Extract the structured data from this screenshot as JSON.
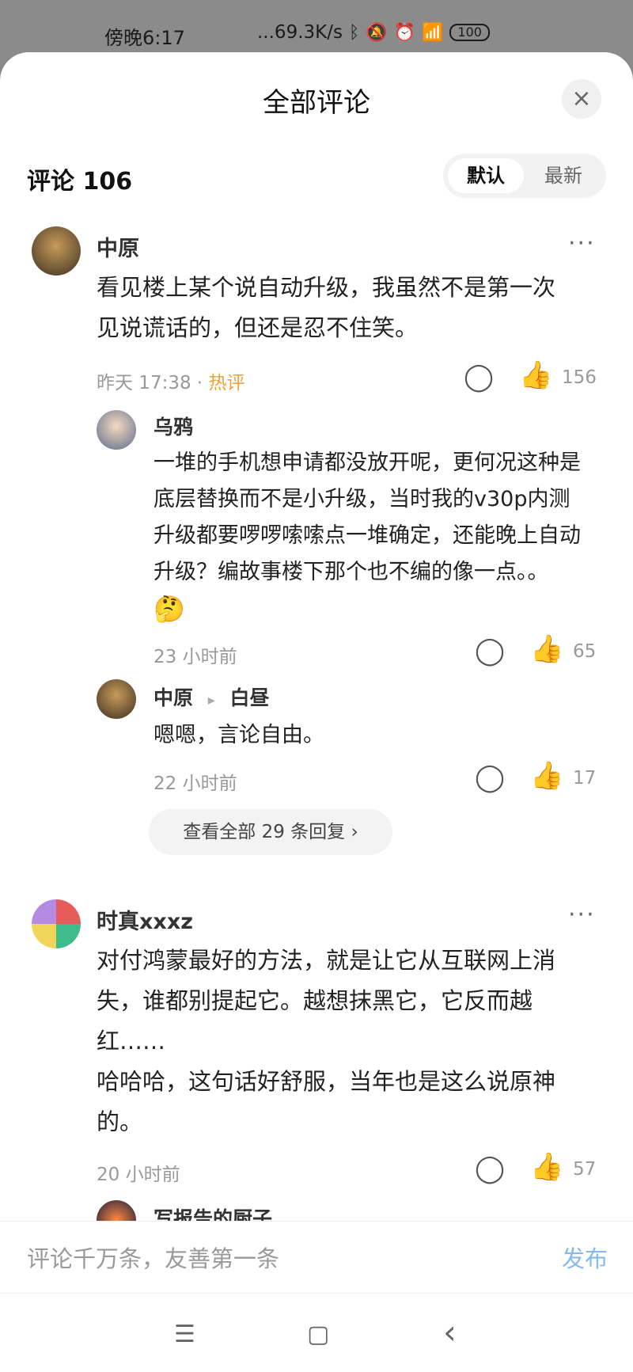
{
  "status": {
    "time": "傍晚6:17",
    "network": "...69.3K/s",
    "battery": "100"
  },
  "sheet": {
    "title": "全部评论",
    "close_icon": "×"
  },
  "comments_header": {
    "label": "评论 106",
    "sort_default": "默认",
    "sort_latest": "最新"
  },
  "comment1": {
    "name": "中原",
    "text_line1": "看见楼上某个说自动升级，我虽然不是第一次",
    "text_line2": "见说谎话的，但还是忍不住笑。",
    "time": "昨天 17:38 ·",
    "tag": "热评",
    "likes": "156"
  },
  "reply1": {
    "name": "乌鸦",
    "line1": "一堆的手机想申请都没放开呢，更何况这种是",
    "line2": "底层替换而不是小升级，当时我的v30p内测",
    "line3": "升级都要啰啰嗦嗦点一堆确定，还能晚上自动",
    "line4": "升级？编故事楼下那个也不编的像一点。。",
    "time": "23 小时前",
    "likes": "65"
  },
  "reply2": {
    "name": "中原",
    "arrow": "▸",
    "to_name": "白昼",
    "text": "嗯嗯，言论自由。",
    "time": "22 小时前",
    "likes": "17"
  },
  "view_all": "查看全部 29 条回复 ›",
  "comment2": {
    "name": "时真xxxz",
    "line1": "对付鸿蒙最好的方法，就是让它从互联网上消",
    "line2": "失，谁都别提起它。越想抹黑它，它反而越",
    "line3": "红……",
    "line4": "哈哈哈，这句话好舒服，当年也是这么说原神",
    "line5": "的。",
    "time": "20 小时前",
    "likes": "57"
  },
  "partial_next": {
    "name": "写报告的厨子"
  },
  "input": {
    "placeholder": "评论千万条，友善第一条",
    "publish": "发布"
  },
  "icons": {
    "more": "···",
    "comment": "◯",
    "like": "👍",
    "menu": "☰",
    "home": "▢",
    "back": "‹"
  }
}
